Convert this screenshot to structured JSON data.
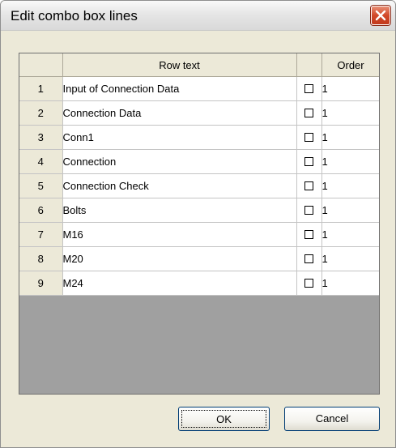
{
  "window": {
    "title": "Edit combo box lines"
  },
  "grid": {
    "headers": {
      "row_text": "Row text",
      "check": "",
      "order": "Order"
    },
    "rows": [
      {
        "num": "1",
        "text": "Input of Connection Data",
        "checked": false,
        "order": "1"
      },
      {
        "num": "2",
        "text": "Connection Data",
        "checked": false,
        "order": "1"
      },
      {
        "num": "3",
        "text": "Conn1",
        "checked": false,
        "order": "1"
      },
      {
        "num": "4",
        "text": "Connection",
        "checked": false,
        "order": "1"
      },
      {
        "num": "5",
        "text": "Connection Check",
        "checked": false,
        "order": "1"
      },
      {
        "num": "6",
        "text": "Bolts",
        "checked": false,
        "order": "1"
      },
      {
        "num": "7",
        "text": "M16",
        "checked": false,
        "order": "1"
      },
      {
        "num": "8",
        "text": "M20",
        "checked": false,
        "order": "1"
      },
      {
        "num": "9",
        "text": "M24",
        "checked": false,
        "order": "1"
      }
    ]
  },
  "buttons": {
    "ok_label": "OK",
    "cancel_label": "Cancel"
  },
  "icons": {
    "close": "close-icon"
  },
  "colors": {
    "dialog_background": "#ece9d8",
    "grid_empty_area": "#a0a0a0",
    "close_button": "#d2492a"
  }
}
